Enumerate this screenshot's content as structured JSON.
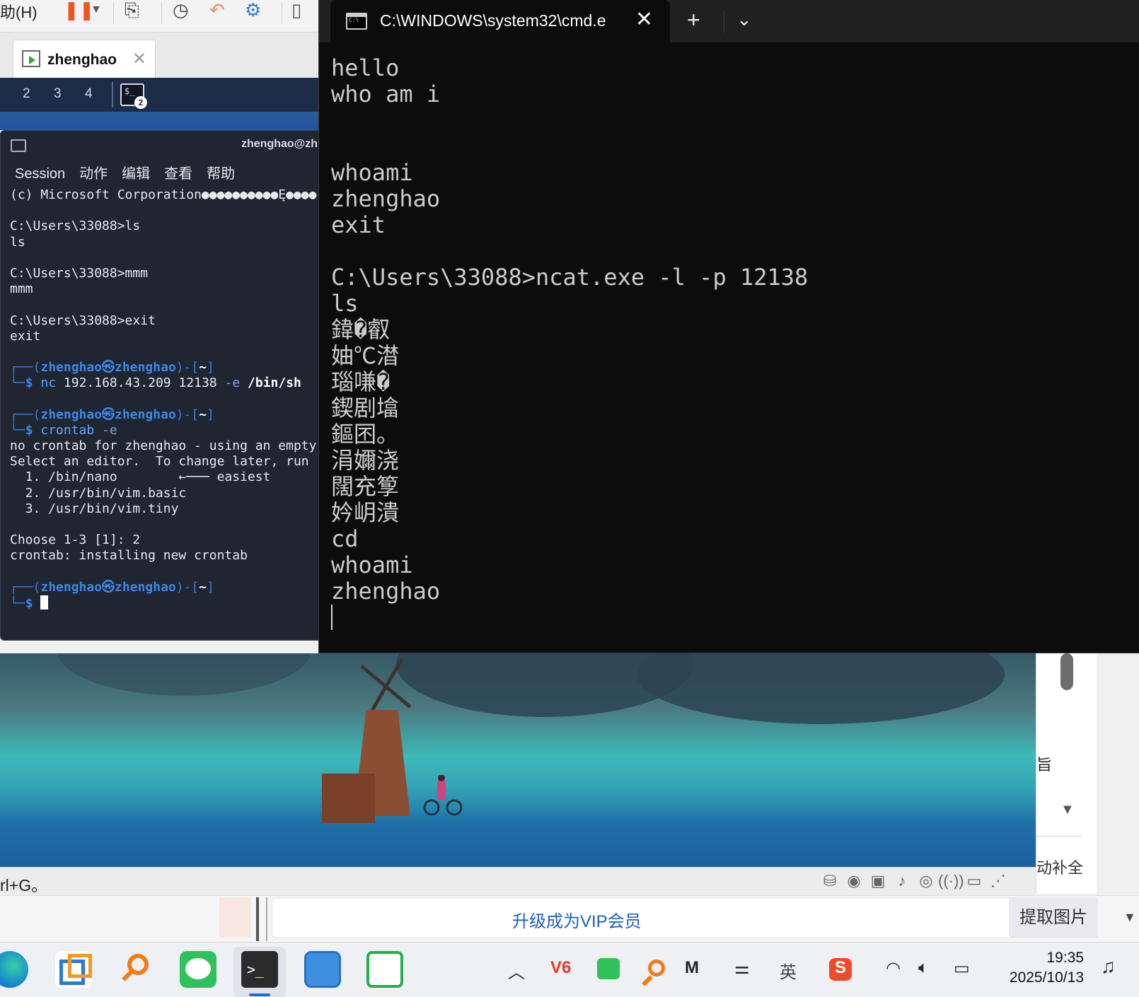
{
  "vmware": {
    "menu_help": "助(H)",
    "tab_label": "zhenghao",
    "tab_close": "✕",
    "status_hint": "rl+G。"
  },
  "guest": {
    "workspaces": [
      "2",
      "3",
      "4"
    ],
    "terminal_badge": "2",
    "terminal": {
      "title": "zhenghao@zh",
      "menu": [
        "Session",
        "动作",
        "编辑",
        "查看",
        "帮助"
      ]
    }
  },
  "windows_terminal": {
    "tab_title": "C:\\WINDOWS\\system32\\cmd.e",
    "tab_close": "✕",
    "new_tab": "+",
    "dropdown": "⌄",
    "lines": [
      "hello",
      "who am i",
      "",
      "",
      "whoami",
      "zhenghao",
      "exit",
      "",
      "C:\\Users\\33088>ncat.exe -l -p 12138",
      "ls",
      "鍏�叡",
      "妯℃澘",
      "瑙嗛�",
      "鍥剧墖",
      "鏂囨。",
      "涓嬭浇",
      "闊充箰",
      "妗岄潰",
      "cd",
      "whoami",
      "zhenghao"
    ]
  },
  "side_panel": {
    "char": "旨",
    "down_arrow": "▼",
    "complete_text": "动补全"
  },
  "bottom": {
    "vip_link": "升级成为VIP会员",
    "extract_button": "提取图片",
    "down_arrow": "▼"
  },
  "taskbar": {
    "terminal_glyph": ">_",
    "tray": {
      "chevron": "︿",
      "v6": "V6",
      "m": "M",
      "ime": "英",
      "sogou": "S"
    },
    "time": "19:35",
    "date": "2025/10/13"
  }
}
